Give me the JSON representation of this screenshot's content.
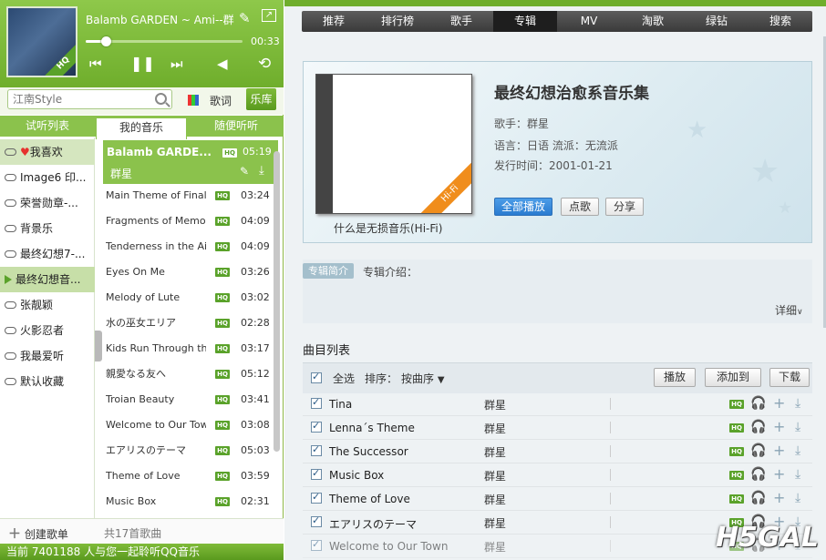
{
  "player": {
    "now_playing": "Balamb GARDEN ~ Ami--群",
    "time": "00:33",
    "progress": 0.13
  },
  "search": {
    "placeholder": "江南Style"
  },
  "toolbar": {
    "lyrics": "歌词",
    "library": "乐库"
  },
  "tabs": [
    "试听列表",
    "我的音乐",
    "随便听听"
  ],
  "playlists": [
    "我喜欢",
    "Image6 印...",
    "荣誉勋章-...",
    "背景乐",
    "最终幻想7-...",
    "最终幻想音...",
    "张靓颖",
    "火影忍者",
    "我最爱听",
    "默认收藏"
  ],
  "current_song": {
    "title": "Balamb GARDE...",
    "time": "05:19",
    "artist": "群星",
    "hq": "HQ"
  },
  "songs": [
    {
      "name": "Main Theme of Final...",
      "time": "03:24"
    },
    {
      "name": "Fragments of Memo...",
      "time": "04:09"
    },
    {
      "name": "Tenderness in the Air",
      "time": "04:09"
    },
    {
      "name": "Eyes On Me",
      "time": "03:26"
    },
    {
      "name": "Melody of Lute",
      "time": "03:02"
    },
    {
      "name": "水の巫女エリア",
      "time": "02:28"
    },
    {
      "name": "Kids Run Through th...",
      "time": "03:17"
    },
    {
      "name": "親愛なる友へ",
      "time": "05:12"
    },
    {
      "name": "Troian Beauty",
      "time": "03:41"
    },
    {
      "name": "Welcome to Our Town",
      "time": "03:08"
    },
    {
      "name": "エアリスのテーマ",
      "time": "05:03"
    },
    {
      "name": "Theme of Love",
      "time": "03:59"
    },
    {
      "name": "Music Box",
      "time": "02:31"
    }
  ],
  "create_playlist": "创建歌单",
  "song_count": "共17首歌曲",
  "status": "当前 7401188 人与您一起聆听QQ音乐",
  "nav": [
    "推荐",
    "排行榜",
    "歌手",
    "专辑",
    "MV",
    "淘歌",
    "绿钻",
    "搜索"
  ],
  "album": {
    "title": "最终幻想治愈系音乐集",
    "artist": "歌手：群星",
    "lang_genre": "语言：日语 流派：无流派",
    "release": "发行时间：2001-01-21",
    "hifi_badge": "Hi-Fi",
    "hifi_link": "什么是无损音乐(Hi-Fi)",
    "play_all": "全部播放",
    "request": "点歌",
    "share": "分享"
  },
  "intro": {
    "tag": "专辑简介",
    "label": "专辑介绍：",
    "detail": "详细"
  },
  "tracks": {
    "title": "曲目列表",
    "select_all": "全选",
    "sort_label": "排序：",
    "sort_value": "按曲序",
    "play": "播放",
    "add_to": "添加到",
    "download": "下载",
    "hq": "HQ",
    "rows": [
      {
        "name": "Tina",
        "artist": "群星"
      },
      {
        "name": "Lenna´s Theme",
        "artist": "群星"
      },
      {
        "name": "The Successor",
        "artist": "群星"
      },
      {
        "name": "Music Box",
        "artist": "群星"
      },
      {
        "name": "Theme of Love",
        "artist": "群星"
      },
      {
        "name": "エアリスのテーマ",
        "artist": "群星"
      },
      {
        "name": "Welcome to Our Town",
        "artist": "群星"
      }
    ]
  },
  "watermark": "H5GAL",
  "colors": {
    "brand_green": "#7fbb39",
    "hq_green": "#5aa22a",
    "hifi_orange": "#f08d1c",
    "primary_blue": "#2a7bd0"
  }
}
